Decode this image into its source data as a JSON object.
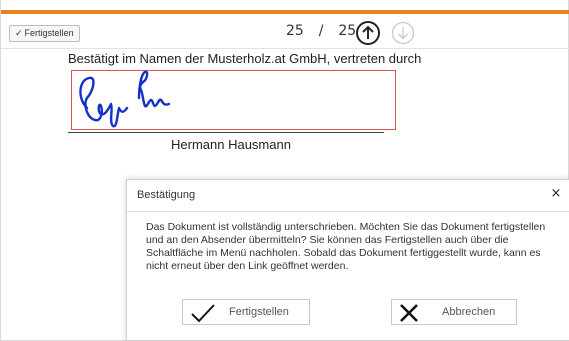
{
  "toolbar": {
    "finish_label": "Fertigstellen",
    "check_glyph": "✓",
    "current_page": "25",
    "page_separator": "/",
    "total_pages": "25",
    "prev_icon": "arrow-up-circle-icon",
    "next_icon": "arrow-down-circle-icon"
  },
  "colors": {
    "accent": "#e8821e",
    "signature_ink": "#1530c8",
    "signature_box": "#e05050",
    "disabled": "#c8c8c8"
  },
  "document": {
    "confirmation_line": "Bestätigt im Namen der Musterholz.at GmbH, vertreten durch",
    "signer_name": "Hermann Hausmann"
  },
  "dialog": {
    "title": "Bestätigung",
    "close_glyph": "×",
    "message": "Das Dokument ist vollständig unterschrieben. Möchten Sie das Dokument fertigstellen und an den Absender übermitteln? Sie können das Fertigstellen auch über die Schaltfläche im Menü nachholen. Sobald das Dokument fertiggestellt wurde, kann es nicht erneut über den Link geöffnet werden.",
    "confirm_label": "Fertigstellen",
    "cancel_label": "Abbrechen"
  }
}
